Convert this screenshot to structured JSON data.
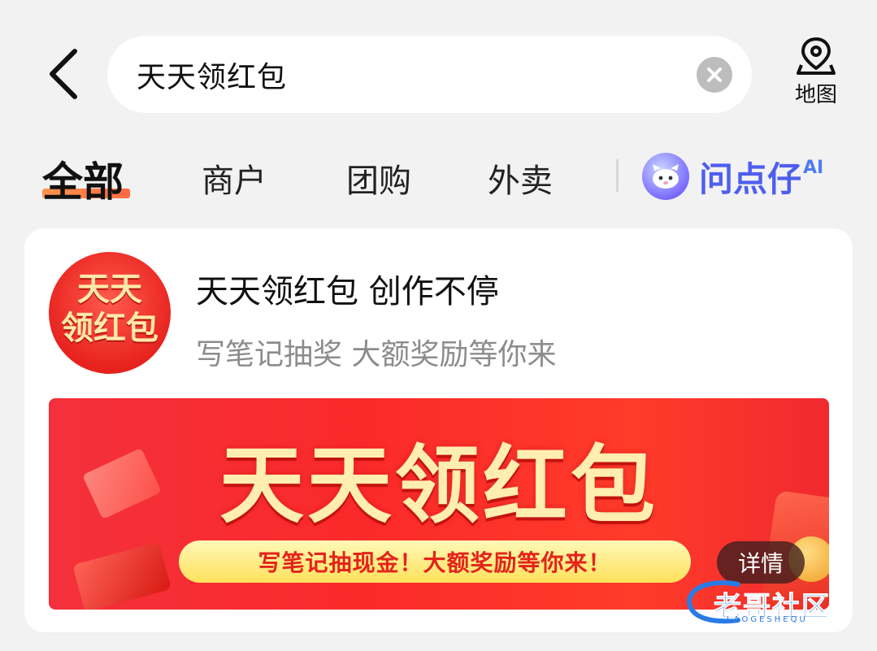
{
  "header": {
    "search_query": "天天领红包",
    "map_label": "地图"
  },
  "tabs": [
    {
      "label": "全部",
      "active": true
    },
    {
      "label": "商户",
      "active": false
    },
    {
      "label": "团购",
      "active": false
    },
    {
      "label": "外卖",
      "active": false
    }
  ],
  "ai_tab": {
    "name": "问点仔",
    "sup": "AI"
  },
  "result_card": {
    "logo_text": "天天领红包",
    "title": "天天领红包 创作不停",
    "subtitle": "写笔记抽奖 大额奖励等你来",
    "banner": {
      "headline": "天天领红包",
      "pill_text": "写笔记抽现金！大额奖励等你来！",
      "details_label": "详情"
    }
  },
  "watermark": {
    "text": "老哥社区",
    "sub": "LAOGESHEQU"
  },
  "colors": {
    "accent": "#ff5b2e",
    "ai_blue": "#4f5ef0",
    "banner_red": "#fb2a2a",
    "pill_yellow": "#ffe15a"
  }
}
